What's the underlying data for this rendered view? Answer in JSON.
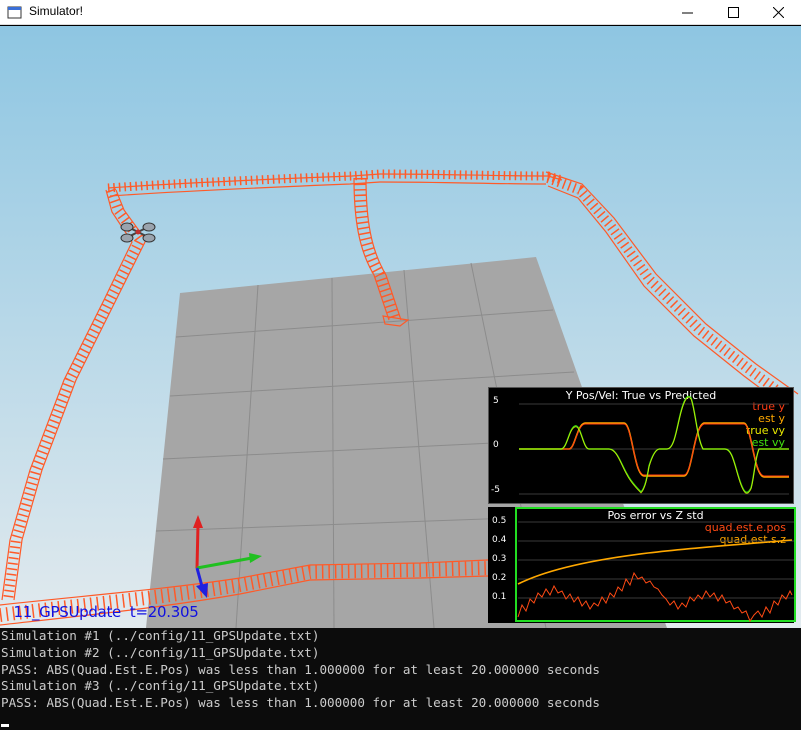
{
  "window": {
    "title": "Simulator!",
    "controls": [
      "minimize-icon",
      "maximize-icon",
      "close-icon"
    ]
  },
  "viewport": {
    "sim_label": " 11_GPSUpdate  t=20.305"
  },
  "plots": [
    {
      "title": "Y Pos/Vel: True vs Predicted",
      "y_ticks": [
        "5",
        "0",
        "-5"
      ],
      "legend": [
        {
          "label": "true y",
          "color": "#ff3c14"
        },
        {
          "label": "est y",
          "color": "#ffa800"
        },
        {
          "label": "true vy",
          "color": "#e8e800"
        },
        {
          "label": "est vy",
          "color": "#40e010"
        }
      ]
    },
    {
      "title": "Pos error vs Z std",
      "y_ticks": [
        "0.5",
        "0.4",
        "0.3",
        "0.2",
        "0.1"
      ],
      "legend": [
        {
          "label": "quad.est.e.pos",
          "color": "#ff4a14"
        },
        {
          "label": "quad.est.s.z",
          "color": "#ffa800"
        }
      ]
    }
  ],
  "console": {
    "lines": [
      "Simulation #1 (../config/11_GPSUpdate.txt)",
      "Simulation #2 (../config/11_GPSUpdate.txt)",
      "PASS: ABS(Quad.Est.E.Pos) was less than 1.000000 for at least 20.000000 seconds",
      "Simulation #3 (../config/11_GPSUpdate.txt)",
      "PASS: ABS(Quad.Est.E.Pos) was less than 1.000000 for at least 20.000000 seconds"
    ]
  },
  "colors": {
    "trajectory": "#ff5a28",
    "sky_top": "#8ec6e2",
    "sky_bottom": "#dde8ee",
    "floor": "#a6a6a6"
  }
}
